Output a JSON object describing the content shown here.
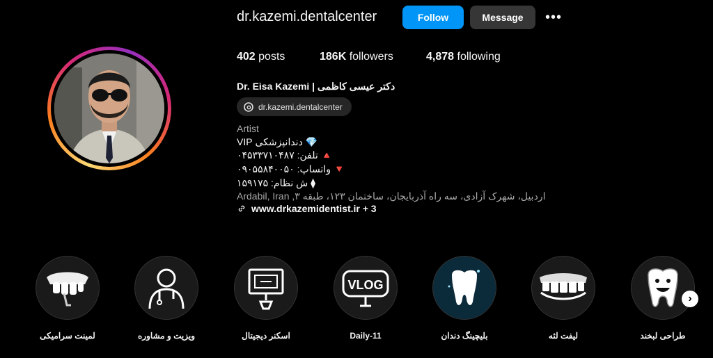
{
  "profile": {
    "username": "dr.kazemi.dentalcenter",
    "follow_label": "Follow",
    "message_label": "Message",
    "more_label": "•••",
    "posts_count": "402",
    "posts_label": "posts",
    "followers_count": "186K",
    "followers_label": "followers",
    "following_count": "4,878",
    "following_label": "following",
    "full_name": "Dr. Eisa Kazemi | دکتر عیسی کاظمی",
    "threads_handle": "dr.kazemi.dentalcenter",
    "category": "Artist",
    "bio_lines": [
      "💎 دندانپزشکی VIP",
      "🔺 تلفن: ۰۴۵۳۳۷۱۰۴۸۷",
      "🔻 واتساپ: ۰۹۰۵۵۸۴۰۰۵۰",
      "⧫ ش نظام: ۱۵۹۱۷۵"
    ],
    "address": "اردبیل، شهرک آزادی، سه راه آذربایجان، ساختمان ۱۲۳، طبقه ۳, Ardabil, Iran",
    "link_text": "www.drkazemidentist.ir + 3"
  },
  "highlights": [
    {
      "label": "لمینت سرامیکی",
      "icon": "veneer-teeth-icon"
    },
    {
      "label": "ویزیت و مشاوره",
      "icon": "doctor-icon"
    },
    {
      "label": "اسکنر دیجیتال",
      "icon": "digital-scanner-icon"
    },
    {
      "label": "Daily-11",
      "icon": "vlog-camera-icon"
    },
    {
      "label": "بلیچینگ دندان",
      "icon": "whitening-tooth-icon"
    },
    {
      "label": "لیفت لثه",
      "icon": "gum-lift-icon"
    },
    {
      "label": "طراحی لبخند",
      "icon": "smiling-tooth-icon"
    }
  ],
  "colors": {
    "follow_button": "#0095f6",
    "message_button": "#363636",
    "background": "#000000"
  }
}
